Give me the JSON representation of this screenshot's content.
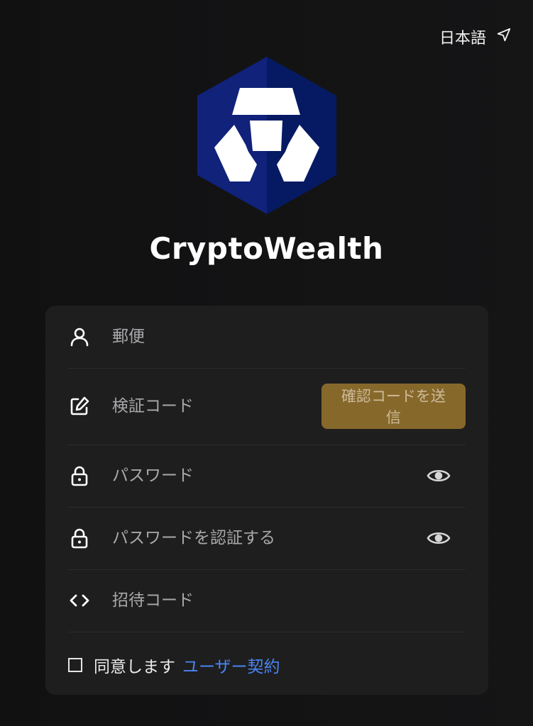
{
  "header": {
    "language_label": "日本語",
    "language_icon": "location-arrow-icon"
  },
  "brand": {
    "name": "CryptoWealth",
    "logo_icon": "lion-hexagon-logo",
    "logo_colors": {
      "left": "#10227a",
      "right": "#061a63",
      "mark": "#ffffff"
    }
  },
  "form": {
    "email": {
      "placeholder": "郵便",
      "value": "",
      "icon": "user-icon"
    },
    "verification": {
      "placeholder": "検証コード",
      "value": "",
      "icon": "edit-icon",
      "send_button_label": "確認コードを送信"
    },
    "password": {
      "placeholder": "パスワード",
      "value": "",
      "icon": "lock-icon",
      "toggle_icon": "eye-icon"
    },
    "confirm_password": {
      "placeholder": "パスワードを認証する",
      "value": "",
      "icon": "lock-icon",
      "toggle_icon": "eye-icon"
    },
    "invite_code": {
      "placeholder": "招待コード",
      "value": "",
      "icon": "code-icon"
    },
    "agreement": {
      "checked": false,
      "text": "同意します",
      "link_text": "ユーザー契約"
    }
  },
  "colors": {
    "background": "#111112",
    "card": "#1e1e1f",
    "accent_button": "#87682b",
    "link": "#4a84f3"
  }
}
